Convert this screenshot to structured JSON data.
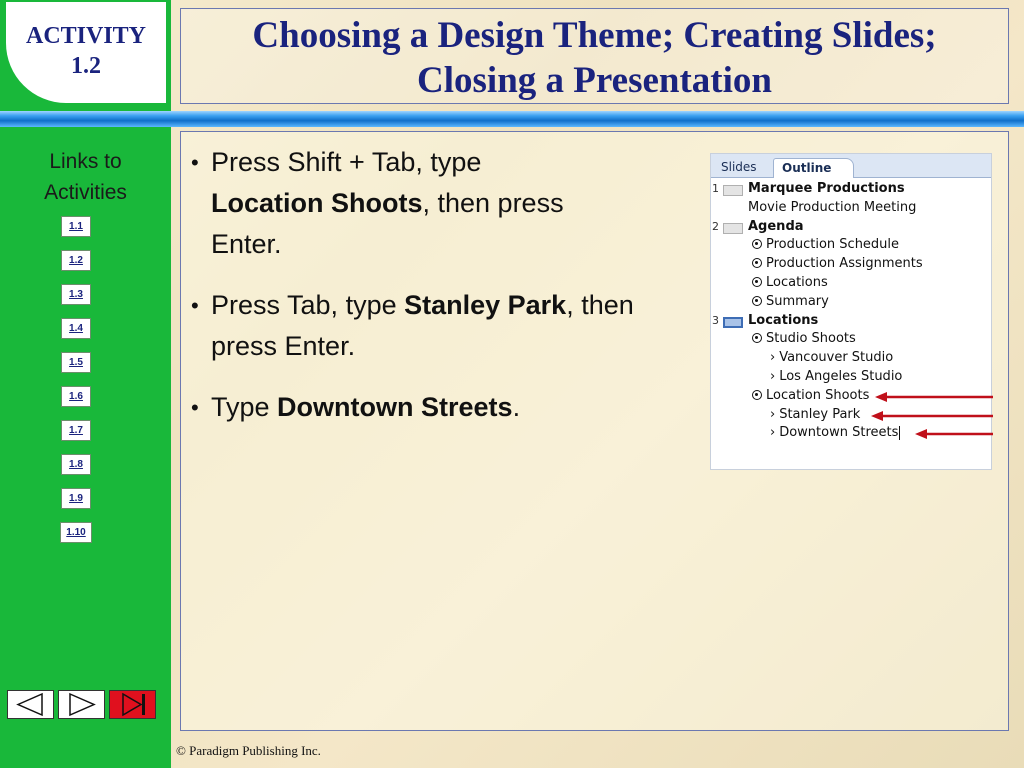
{
  "activity": {
    "label": "ACTIVITY",
    "number": "1.2"
  },
  "header": {
    "line1": "Choosing a Design Theme; Creating Slides;",
    "line2": "Closing a Presentation"
  },
  "sidebar": {
    "links_title_line1": "Links to",
    "links_title_line2": "Activities",
    "links": [
      "1.1",
      "1.2",
      "1.3",
      "1.4",
      "1.5",
      "1.6",
      "1.7",
      "1.8",
      "1.9",
      "1.10"
    ]
  },
  "navigation": {
    "prev_icon": "triangle-left-icon",
    "next_icon": "triangle-right-icon",
    "end_icon": "end-show-icon"
  },
  "bullets": [
    {
      "before": "Press Shift + Tab, type ",
      "bold": "Location Shoots",
      "after": ", then press Enter."
    },
    {
      "before": "Press Tab, type ",
      "bold": "Stanley Park",
      "after": ", then press Enter."
    },
    {
      "before": "Type ",
      "bold": "Downtown Streets",
      "after": "."
    }
  ],
  "outline_pane": {
    "tabs": {
      "slides": "Slides",
      "outline": "Outline"
    },
    "slide1": {
      "number": "1",
      "title": "Marquee Productions",
      "subtitle": "Movie Production  Meeting"
    },
    "slide2": {
      "number": "2",
      "title": "Agenda",
      "items": [
        "Production  Schedule",
        "Production  Assignments",
        "Locations",
        "Summary"
      ]
    },
    "slide3": {
      "number": "3",
      "title": "Locations",
      "item1": "Studio Shoots",
      "item1_sub": [
        "Vancouver Studio",
        "Los Angeles Studio"
      ],
      "item2": "Location Shoots",
      "item2_sub": [
        "Stanley Park",
        "Downtown Streets"
      ]
    },
    "arrow_color": "#c0101a"
  },
  "colors": {
    "sidebar_green": "#19b83a",
    "title_navy": "#1a237e",
    "rule_blue": "#0f6fc9",
    "end_button_red": "#e0101e"
  },
  "footer": {
    "copyright": "© Paradigm Publishing Inc."
  }
}
